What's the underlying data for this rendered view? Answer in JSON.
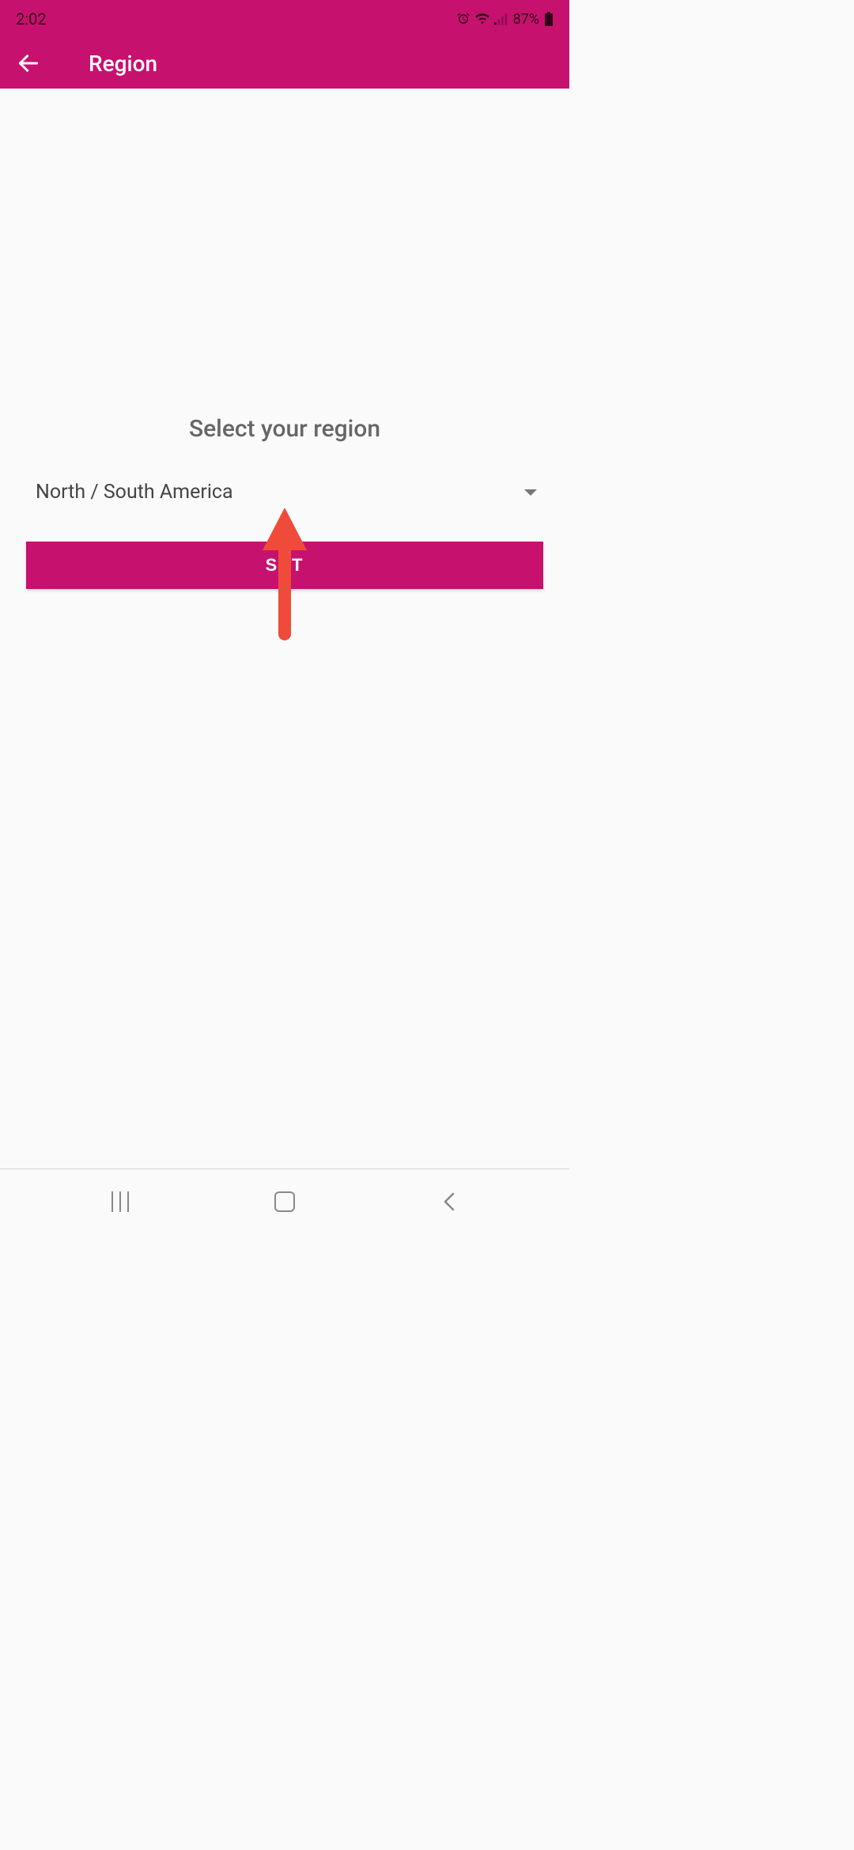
{
  "status_bar": {
    "time": "2:02",
    "battery_percent": "87%"
  },
  "app_bar": {
    "title": "Region"
  },
  "main": {
    "prompt": "Select your region",
    "selected_region": "North / South America",
    "set_button_label": "SET"
  },
  "colors": {
    "brand": "#c7116e",
    "annotation": "#f04a3a"
  }
}
